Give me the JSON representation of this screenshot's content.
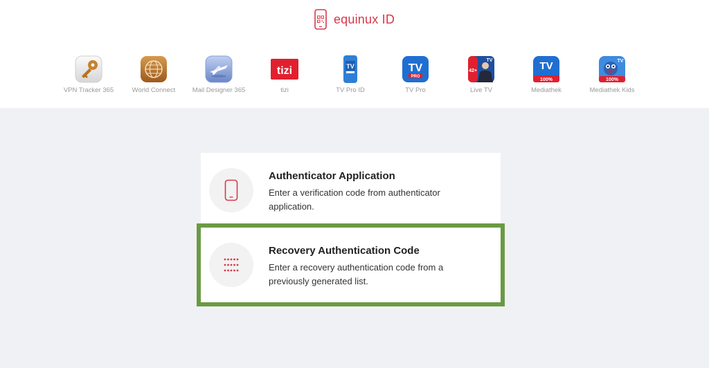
{
  "brand": {
    "name": "equinux ID",
    "color": "#d9384a"
  },
  "apps": [
    {
      "label": "VPN Tracker 365",
      "icon": "key-icon"
    },
    {
      "label": "World Connect",
      "icon": "globe-icon"
    },
    {
      "label": "Mail Designer 365",
      "icon": "airplane-icon"
    },
    {
      "label": "tizi",
      "icon": "tizi-icon",
      "icon_text": "tizi"
    },
    {
      "label": "TV Pro ID",
      "icon": "tv-pro-id-icon",
      "icon_text": "TV"
    },
    {
      "label": "TV Pro",
      "icon": "tv-pro-icon",
      "icon_text": "TV",
      "badge": "PRO"
    },
    {
      "label": "Live TV",
      "icon": "live-tv-icon",
      "icon_text": "TV",
      "badge": "42+"
    },
    {
      "label": "Mediathek",
      "icon": "mediathek-icon",
      "icon_text": "TV",
      "badge": "100%"
    },
    {
      "label": "Mediathek Kids",
      "icon": "mediathek-kids-icon",
      "icon_text": "TV",
      "badge": "100%"
    }
  ],
  "options": [
    {
      "title": "Authenticator Application",
      "description": "Enter a verification code from authenticator application.",
      "icon": "phone-icon"
    },
    {
      "title": "Recovery Authentication Code",
      "description": "Enter a recovery authentication code from a previously generated list.",
      "icon": "dots-grid-icon"
    }
  ],
  "colors": {
    "accent": "#d9384a",
    "selection_outline": "#6a9a43",
    "background": "#f0f1f4"
  }
}
